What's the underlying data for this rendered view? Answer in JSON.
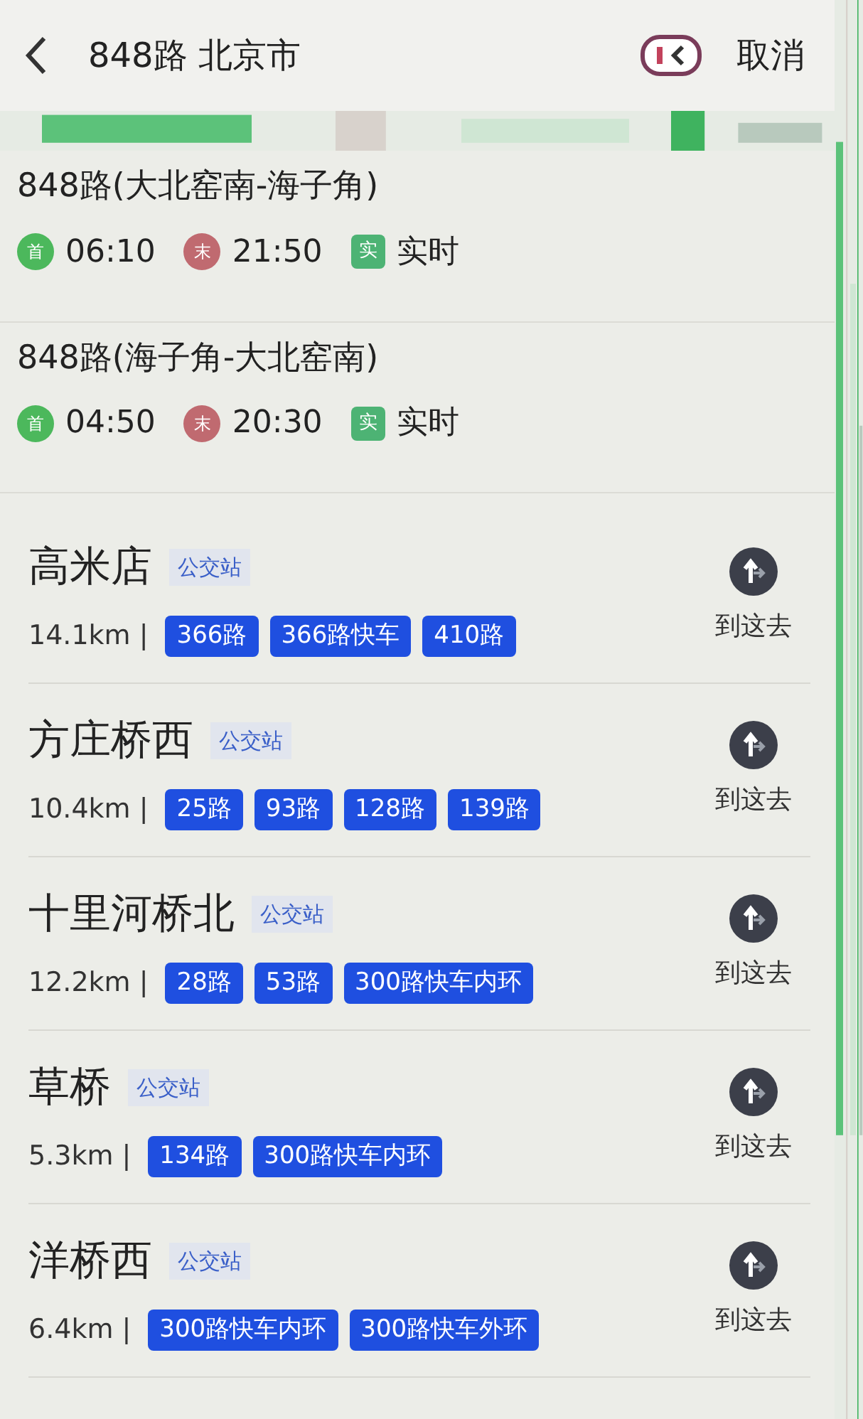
{
  "header": {
    "title": "848路 北京市",
    "cancel": "取消"
  },
  "routes": [
    {
      "name": "848路(大北窑南-海子角)",
      "first_badge": "首",
      "first": "06:10",
      "last_badge": "末",
      "last": "21:50",
      "realtime_badge": "实",
      "realtime": "实时"
    },
    {
      "name": "848路(海子角-大北窑南)",
      "first_badge": "首",
      "first": "04:50",
      "last_badge": "末",
      "last": "20:30",
      "realtime_badge": "实",
      "realtime": "实时"
    }
  ],
  "stations": [
    {
      "name": "高米店",
      "type": "公交站",
      "distance": "14.1km |",
      "lines": [
        "366路",
        "366路快车",
        "410路"
      ],
      "action": "到这去"
    },
    {
      "name": "方庄桥西",
      "type": "公交站",
      "distance": "10.4km |",
      "lines": [
        "25路",
        "93路",
        "128路",
        "139路"
      ],
      "action": "到这去"
    },
    {
      "name": "十里河桥北",
      "type": "公交站",
      "distance": "12.2km |",
      "lines": [
        "28路",
        "53路",
        "300路快车内环"
      ],
      "action": "到这去"
    },
    {
      "name": "草桥",
      "type": "公交站",
      "distance": "5.3km |",
      "lines": [
        "134路",
        "300路快车内环"
      ],
      "action": "到这去"
    },
    {
      "name": "洋桥西",
      "type": "公交站",
      "distance": "6.4km |",
      "lines": [
        "300路快车内环",
        "300路快车外环"
      ],
      "action": "到这去"
    }
  ]
}
